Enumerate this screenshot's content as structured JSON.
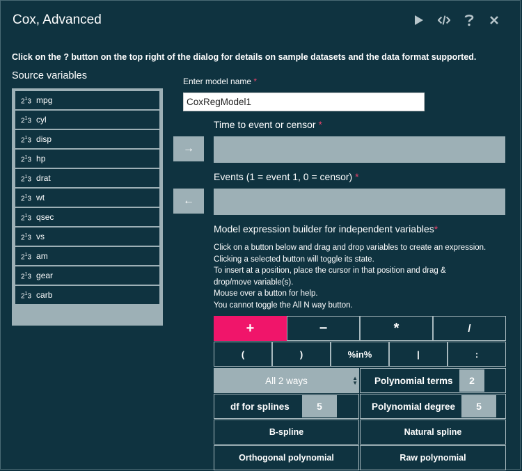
{
  "window": {
    "title": "Cox, Advanced"
  },
  "toolbar": {
    "icons": [
      "play-icon",
      "code-icon",
      "help-icon",
      "close-icon"
    ]
  },
  "notice": "Click on the ? button on the top right of the dialog for details on sample datasets and the data format supported.",
  "source": {
    "title": "Source variables",
    "icon_text": "2",
    "icon_sup": "1",
    "icon_tail": "3",
    "variables": [
      "mpg",
      "cyl",
      "disp",
      "hp",
      "drat",
      "wt",
      "qsec",
      "vs",
      "am",
      "gear",
      "carb"
    ]
  },
  "model_name": {
    "label": "Enter model name",
    "value": "CoxRegModel1",
    "required_mark": "*"
  },
  "time_field": {
    "label": "Time to event or censor",
    "required_mark": "*"
  },
  "events_field": {
    "label": "Events (1 = event 1, 0 = censor)",
    "required_mark": "*"
  },
  "move_buttons": {
    "right": "→",
    "left": "←"
  },
  "builder": {
    "title": "Model expression builder for independent variables",
    "required_mark": "*",
    "help": [
      "Click on a button below and drag and drop variables to create an expression.",
      "Clicking a selected button will toggle its state.",
      "To insert at a position, place the cursor in that position and drag &",
      "drop/move variable(s).",
      "Mouse over a button for help.",
      "You cannot toggle the All N way button."
    ],
    "row1": [
      "+",
      "−",
      "*",
      "/"
    ],
    "row2": [
      "(",
      ")",
      "%in%",
      "|",
      ":"
    ],
    "all_ways": "All 2 ways",
    "polynomial_terms": {
      "label": "Polynomial terms",
      "value": "2"
    },
    "df_splines": {
      "label": "df for splines",
      "value": "5"
    },
    "polynomial_degree": {
      "label": "Polynomial degree",
      "value": "5"
    },
    "bspline": "B-spline",
    "natural_spline": "Natural spline",
    "orthogonal_polynomial": "Orthogonal polynomial",
    "raw_polynomial": "Raw polynomial"
  },
  "colors": {
    "background": "#0f3340",
    "accent": "#f0156a",
    "field": "#9db0b6"
  }
}
